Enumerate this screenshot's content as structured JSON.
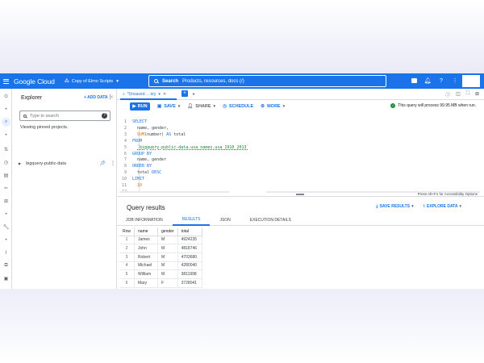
{
  "header": {
    "logo": "Google Cloud",
    "project": "Copy of Elmo Scripts",
    "search_label": "Search",
    "search_placeholder": "Products, resources, docs (/)"
  },
  "explorer": {
    "title": "Explorer",
    "add_data": "+ ADD DATA",
    "search_placeholder": "Type to search",
    "help_glyph": "?",
    "pinned_text": "Viewing pinned projects.",
    "tree": [
      {
        "label": "bigquery-public-data"
      }
    ]
  },
  "editor_tab": {
    "label": "*Unsaved ... ery"
  },
  "toolbar": {
    "run": "RUN",
    "save": "SAVE",
    "share": "SHARE",
    "schedule": "SCHEDULE",
    "more": "MORE",
    "status": "This query will process 99.95 MB when run."
  },
  "code": [
    {
      "n": "1",
      "tokens": [
        {
          "t": "SELECT",
          "c": "kw"
        }
      ]
    },
    {
      "n": "2",
      "tokens": [
        {
          "t": "  name, gender,",
          "c": "plain"
        }
      ]
    },
    {
      "n": "3",
      "tokens": [
        {
          "t": "  SUM",
          "c": "fn"
        },
        {
          "t": "(number) ",
          "c": "plain"
        },
        {
          "t": "AS",
          "c": "kw"
        },
        {
          "t": " total",
          "c": "plain"
        }
      ]
    },
    {
      "n": "4",
      "tokens": [
        {
          "t": "FROM",
          "c": "kw"
        }
      ]
    },
    {
      "n": "5",
      "tokens": [
        {
          "t": "  ",
          "c": "plain"
        },
        {
          "t": "`bigquery-public-data.usa_names.usa_1910_2013`",
          "c": "str"
        }
      ]
    },
    {
      "n": "6",
      "tokens": [
        {
          "t": "GROUP BY",
          "c": "kw"
        }
      ]
    },
    {
      "n": "7",
      "tokens": [
        {
          "t": "  name, gender",
          "c": "plain"
        }
      ]
    },
    {
      "n": "8",
      "tokens": [
        {
          "t": "ORDER BY",
          "c": "kw"
        }
      ]
    },
    {
      "n": "9",
      "tokens": [
        {
          "t": "  total ",
          "c": "plain"
        },
        {
          "t": "DESC",
          "c": "kw"
        }
      ]
    },
    {
      "n": "10",
      "tokens": [
        {
          "t": "LIMIT",
          "c": "kw"
        }
      ]
    },
    {
      "n": "11",
      "tokens": [
        {
          "t": "  10",
          "c": "num"
        }
      ]
    },
    {
      "n": "12",
      "tokens": []
    }
  ],
  "editor_hint": "Press Alt+F1 for Accessibility Options",
  "results": {
    "title": "Query results",
    "save_results": "SAVE RESULTS",
    "explore_data": "EXPLORE DATA",
    "tabs": [
      "JOB INFORMATION",
      "RESULTS",
      "JSON",
      "EXECUTION DETAILS"
    ],
    "active_tab": 1,
    "columns": [
      "Row",
      "name",
      "gender",
      "total"
    ],
    "rows": [
      [
        "1",
        "James",
        "M",
        "4924235"
      ],
      [
        "2",
        "John",
        "M",
        "4818746"
      ],
      [
        "3",
        "Robert",
        "M",
        "4703680"
      ],
      [
        "4",
        "Michael",
        "M",
        "4280040"
      ],
      [
        "5",
        "William",
        "M",
        "3811998"
      ],
      [
        "6",
        "Mary",
        "F",
        "3728041"
      ]
    ]
  }
}
